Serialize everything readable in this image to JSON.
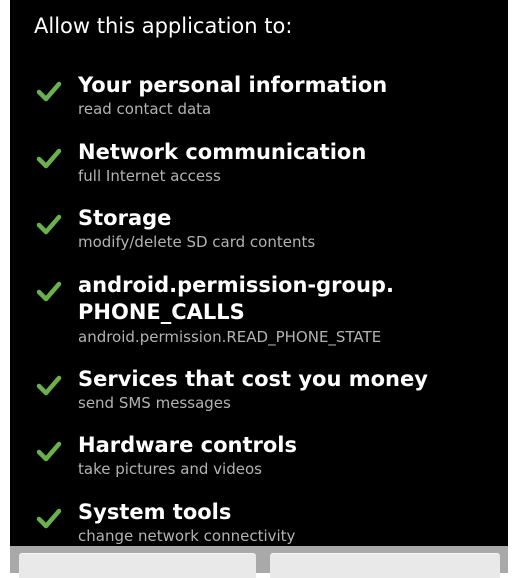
{
  "header": {
    "text": "Allow this application to:"
  },
  "accent_color": "#6ab04c",
  "permissions": [
    {
      "icon": "checkmark-icon",
      "title": "Your personal information",
      "detail": "read contact data"
    },
    {
      "icon": "checkmark-icon",
      "title": "Network communication",
      "detail": "full Internet access"
    },
    {
      "icon": "checkmark-icon",
      "title": "Storage",
      "detail": "modify/delete SD card contents"
    },
    {
      "icon": "checkmark-icon",
      "title_line1": "android.permission-group.",
      "title_line2": "PHONE_CALLS",
      "detail": "android.permission.READ_PHONE_STATE"
    },
    {
      "icon": "checkmark-icon",
      "title": "Services that cost you money",
      "detail": "send SMS messages"
    },
    {
      "icon": "checkmark-icon",
      "title": "Hardware controls",
      "detail": "take pictures and videos"
    },
    {
      "icon": "checkmark-icon",
      "title": "System tools",
      "detail": "change network connectivity"
    }
  ],
  "buttons": [
    {
      "name": "install-button"
    },
    {
      "name": "cancel-button"
    }
  ]
}
